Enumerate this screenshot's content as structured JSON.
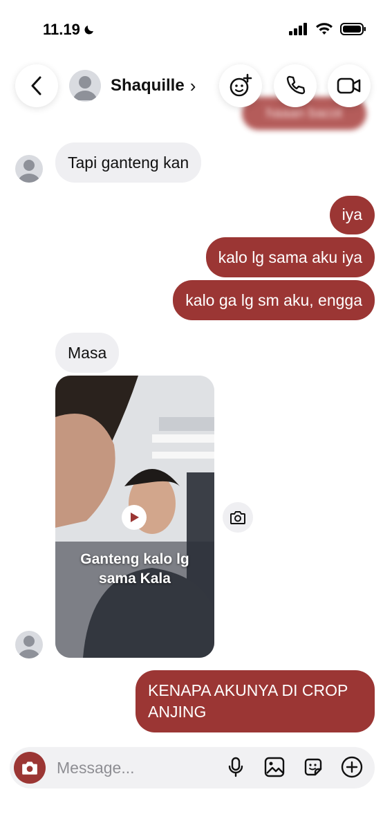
{
  "status_bar": {
    "time": "11.19"
  },
  "header": {
    "contact_name": "Shaquille",
    "chevron": "›"
  },
  "ghost_message": "haaan bacot",
  "messages": [
    {
      "side": "in",
      "text": "Tapi ganteng kan"
    },
    {
      "side": "out",
      "text": "iya"
    },
    {
      "side": "out",
      "text": "kalo lg sama aku iya"
    },
    {
      "side": "out",
      "text": "kalo ga lg sm aku, engga"
    },
    {
      "side": "in",
      "text": "Masa"
    }
  ],
  "video": {
    "caption_line1": "Ganteng kalo lg",
    "caption_line2": "sama Kala"
  },
  "last_message": {
    "line1": "KENAPA AKUNYA DI CROP",
    "line2": "ANJING"
  },
  "composer": {
    "placeholder": "Message..."
  },
  "colors": {
    "accent": "#9b3634",
    "incoming_bubble": "#efeff2"
  }
}
